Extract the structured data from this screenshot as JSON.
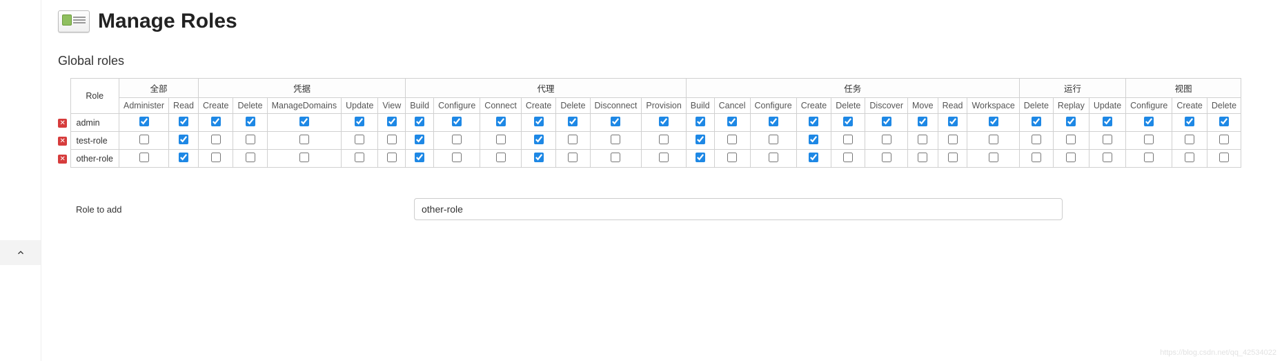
{
  "header": {
    "title": "Manage Roles"
  },
  "section": {
    "title": "Global roles"
  },
  "role_header": "Role",
  "groups": [
    {
      "label": "全部",
      "perms": [
        "Administer",
        "Read"
      ]
    },
    {
      "label": "凭据",
      "perms": [
        "Create",
        "Delete",
        "ManageDomains",
        "Update",
        "View"
      ]
    },
    {
      "label": "代理",
      "perms": [
        "Build",
        "Configure",
        "Connect",
        "Create",
        "Delete",
        "Disconnect",
        "Provision"
      ]
    },
    {
      "label": "任务",
      "perms": [
        "Build",
        "Cancel",
        "Configure",
        "Create",
        "Delete",
        "Discover",
        "Move",
        "Read",
        "Workspace"
      ]
    },
    {
      "label": "运行",
      "perms": [
        "Delete",
        "Replay",
        "Update"
      ]
    },
    {
      "label": "视图",
      "perms": [
        "Configure",
        "Create",
        "Delete"
      ]
    }
  ],
  "roles": [
    {
      "name": "admin",
      "checked": [
        true,
        true,
        true,
        true,
        true,
        true,
        true,
        true,
        true,
        true,
        true,
        true,
        true,
        true,
        true,
        true,
        true,
        true,
        true,
        true,
        true,
        true,
        true,
        true,
        true,
        true,
        true,
        true,
        true
      ]
    },
    {
      "name": "test-role",
      "checked": [
        false,
        true,
        false,
        false,
        false,
        false,
        false,
        true,
        false,
        false,
        true,
        false,
        false,
        false,
        true,
        false,
        false,
        true,
        false,
        false,
        false,
        false,
        false,
        false,
        false,
        false,
        false,
        false,
        false
      ]
    },
    {
      "name": "other-role",
      "checked": [
        false,
        true,
        false,
        false,
        false,
        false,
        false,
        true,
        false,
        false,
        true,
        false,
        false,
        false,
        true,
        false,
        false,
        true,
        false,
        false,
        false,
        false,
        false,
        false,
        false,
        false,
        false,
        false,
        false
      ]
    }
  ],
  "add": {
    "label": "Role to add",
    "value": "other-role"
  },
  "watermark": "https://blog.csdn.net/qq_42534022"
}
